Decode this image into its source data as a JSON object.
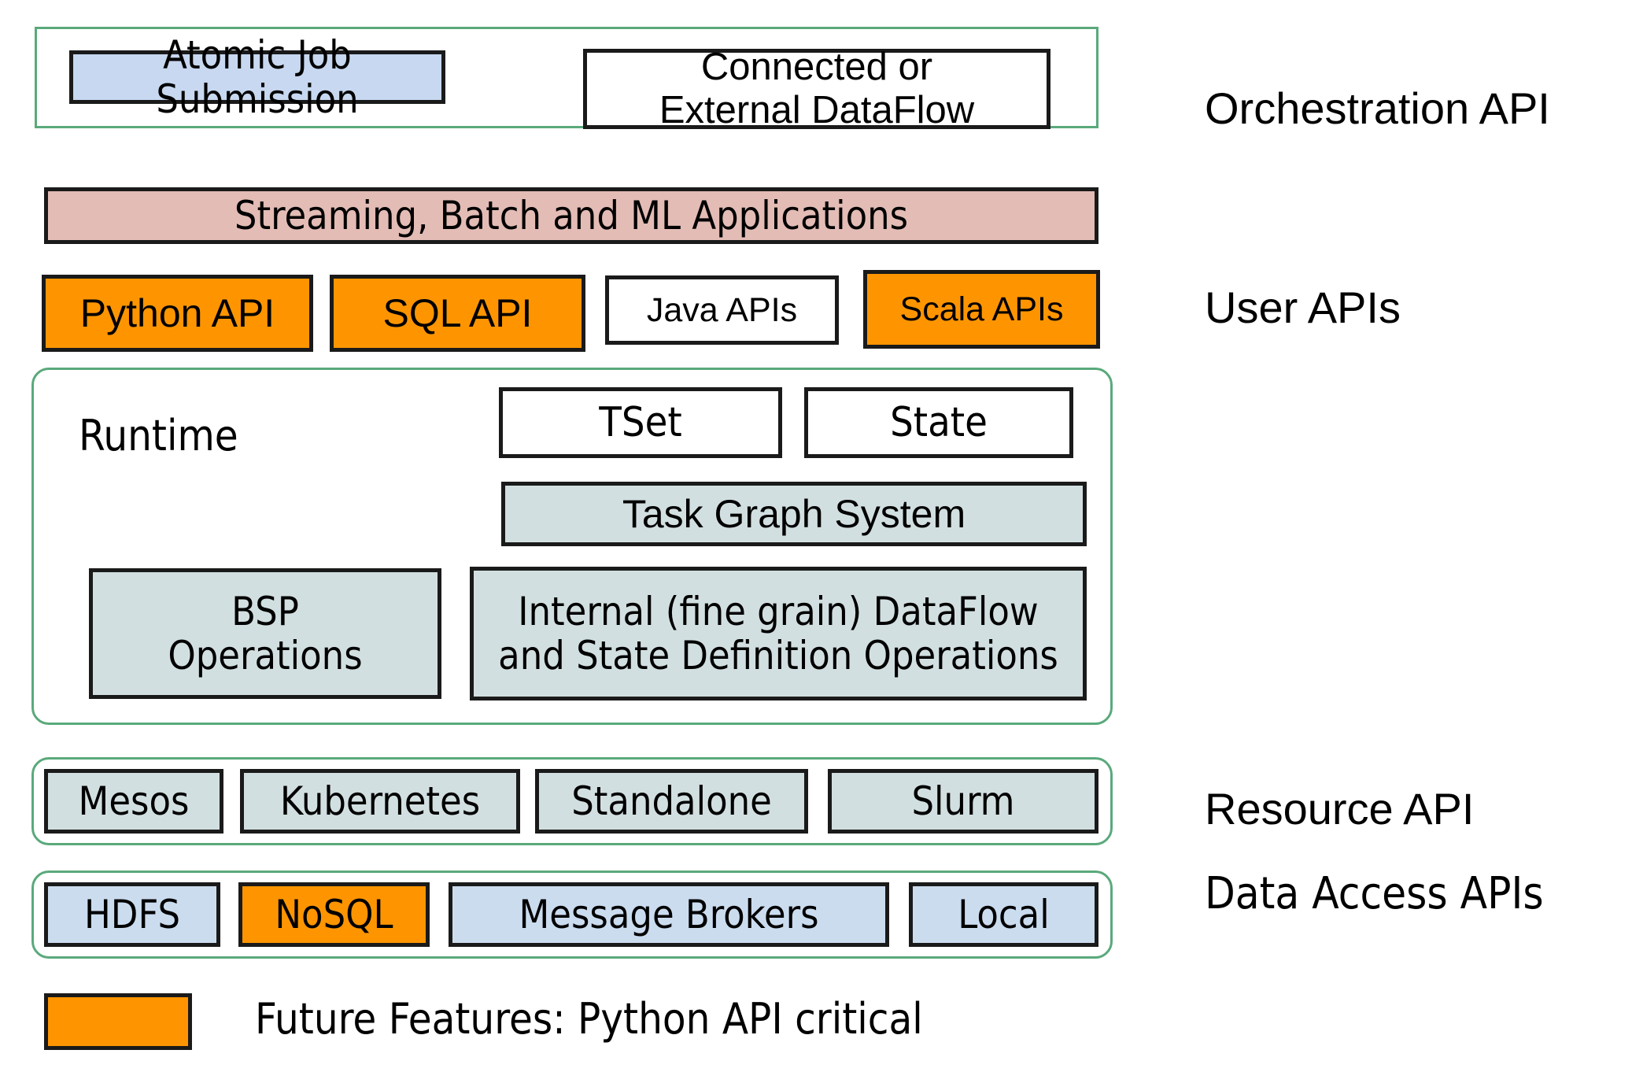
{
  "diagram": {
    "title": "Twister2 / Big Data Stack Layered Architecture",
    "colors": {
      "container_border": "#5aa97b",
      "box_border": "#1a1a1a",
      "blue": "#c7d8f0",
      "white": "#ffffff",
      "pink": "#e3bcb5",
      "orange": "#fe9500",
      "steel_blue_grey": "#d2dfe1",
      "light_blue": "#cbdcef"
    }
  },
  "tiers": {
    "orchestration": {
      "label": "Orchestration API",
      "boxes": [
        {
          "label": "Atomic Job\nSubmission",
          "line1": "Atomic Job",
          "line2": "Submission",
          "fill": "blue"
        },
        {
          "label": "Connected or\nExternal DataFlow",
          "line1": "Connected or",
          "line2": "External DataFlow",
          "fill": "white"
        }
      ]
    },
    "applications": {
      "label": "",
      "boxes": [
        {
          "label": "Streaming, Batch and ML Applications",
          "fill": "pink"
        }
      ]
    },
    "user_apis": {
      "label": "User APIs",
      "boxes": [
        {
          "label": "Python API",
          "fill": "orange"
        },
        {
          "label": "SQL API",
          "fill": "orange"
        },
        {
          "label": "Java APIs",
          "fill": "white"
        },
        {
          "label": "Scala APIs",
          "fill": "orange"
        }
      ]
    },
    "runtime": {
      "label": "",
      "caption": "Runtime",
      "boxes": [
        {
          "label": "TSet",
          "fill": "white"
        },
        {
          "label": "State",
          "fill": "white"
        },
        {
          "label": "Task Graph System",
          "fill": "steel"
        },
        {
          "label": "BSP\nOperations",
          "line1": "BSP",
          "line2": "Operations",
          "fill": "steel"
        },
        {
          "label": "Internal (fine grain) DataFlow and State Definition Operations",
          "line1": "Internal (fine grain) DataFlow",
          "line2": "and State Definition Operations",
          "fill": "steel"
        }
      ]
    },
    "resource": {
      "label": "Resource API",
      "boxes": [
        {
          "label": "Mesos",
          "fill": "steel"
        },
        {
          "label": "Kubernetes",
          "fill": "steel"
        },
        {
          "label": "Standalone",
          "fill": "steel"
        },
        {
          "label": "Slurm",
          "fill": "steel"
        }
      ]
    },
    "data_access": {
      "label": "Data Access APIs",
      "boxes": [
        {
          "label": "HDFS",
          "fill": "lblue"
        },
        {
          "label": "NoSQL",
          "fill": "orange"
        },
        {
          "label": "Message Brokers",
          "fill": "lblue"
        },
        {
          "label": "Local",
          "fill": "lblue"
        }
      ]
    }
  },
  "legend": {
    "swatch_fill": "#fe9500",
    "text": "Future Features: Python API critical"
  }
}
